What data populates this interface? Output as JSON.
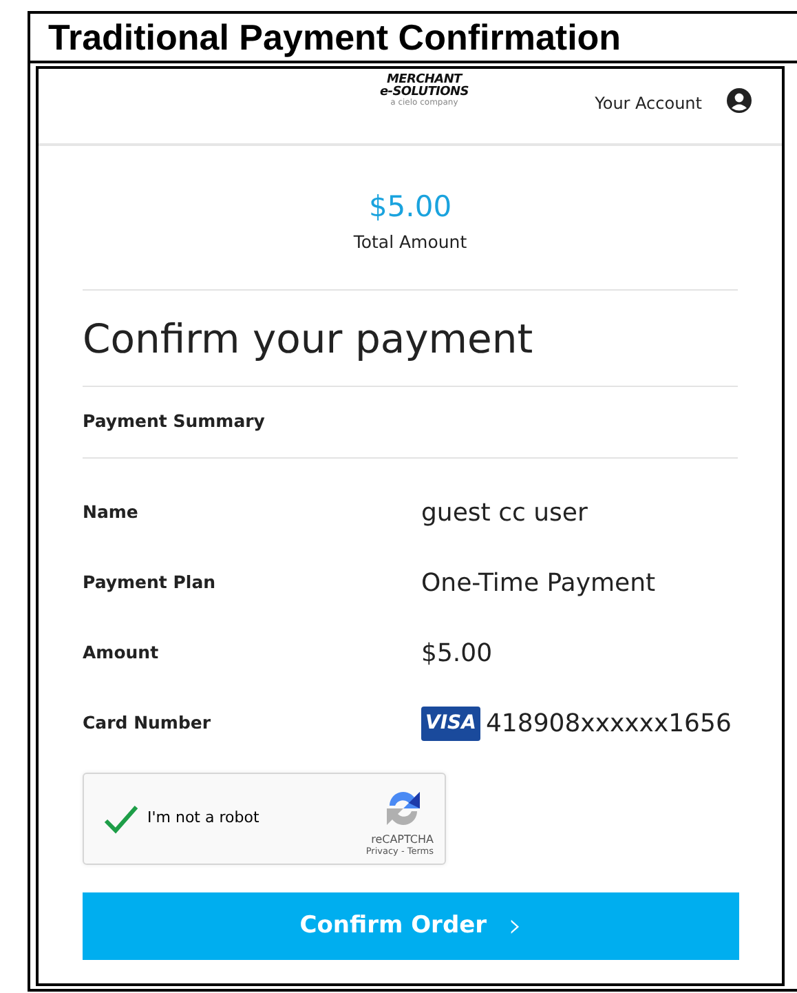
{
  "heading": "Traditional Payment Confirmation",
  "header": {
    "logo_lines": [
      "MERCHANT",
      "e-SOLUTIONS",
      "a cielo company"
    ],
    "account_label": "Your Account"
  },
  "total": {
    "amount": "$5.00",
    "label": "Total Amount"
  },
  "title": "Confirm your payment",
  "section": "Payment Summary",
  "rows": [
    {
      "label": "Name",
      "value": "guest cc user",
      "kind": "text"
    },
    {
      "label": "Payment Plan",
      "value": "One-Time Payment",
      "kind": "text"
    },
    {
      "label": "Amount",
      "value": "$5.00",
      "kind": "text"
    },
    {
      "label": "Card Number",
      "value": "418908xxxxxx1656",
      "kind": "card",
      "card_brand": "VISA"
    }
  ],
  "captcha": {
    "label": "I'm not a robot",
    "checked": true,
    "brand": "reCAPTCHA",
    "links": "Privacy - Terms"
  },
  "button": {
    "label": "Confirm Order",
    "arrow": "›"
  }
}
